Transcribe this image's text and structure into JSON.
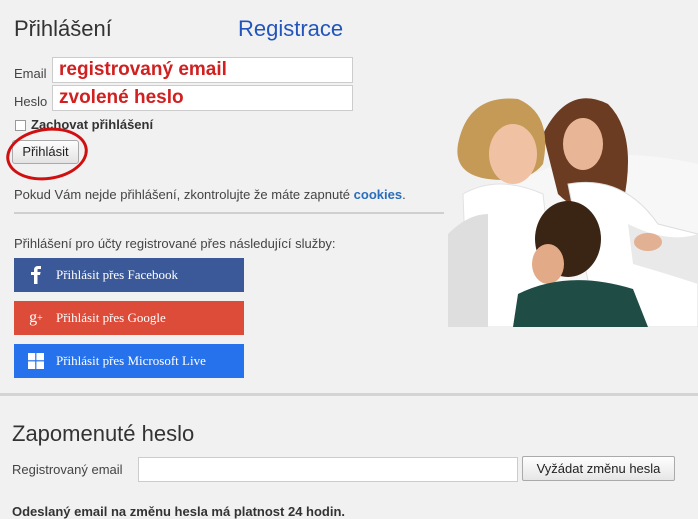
{
  "login": {
    "title": "Přihlášení",
    "register_link": "Registrace",
    "email_label": "Email",
    "email_overlay": "registrovaný email",
    "password_label": "Heslo",
    "password_overlay": "zvolené heslo",
    "remember_label": "Zachovat přihlášení",
    "login_button": "Přihlásit",
    "cookies_note_prefix": "Pokud Vám nejde přihlášení, zkontrolujte že máte zapnuté ",
    "cookies_link": "cookies",
    "cookies_note_suffix": "."
  },
  "services": {
    "intro": "Přihlášení pro účty registrované přes následující služby:",
    "items": [
      {
        "label": "Přihlásit přes Facebook",
        "icon": "facebook-icon",
        "color": "#3b5998"
      },
      {
        "label": "Přihlásit přes Google",
        "icon": "google-plus-icon",
        "color": "#dd4b39"
      },
      {
        "label": "Přihlásit přes Microsoft Live",
        "icon": "windows-icon",
        "color": "#2672ec"
      }
    ]
  },
  "forgot": {
    "title": "Zapomenuté heslo",
    "email_label": "Registrovaný email",
    "request_button": "Vyžádat změnu hesla",
    "note": "Odeslaný email na změnu hesla má platnost 24 hodin."
  },
  "colors": {
    "link": "#2255bb",
    "annotation": "#d02020"
  }
}
